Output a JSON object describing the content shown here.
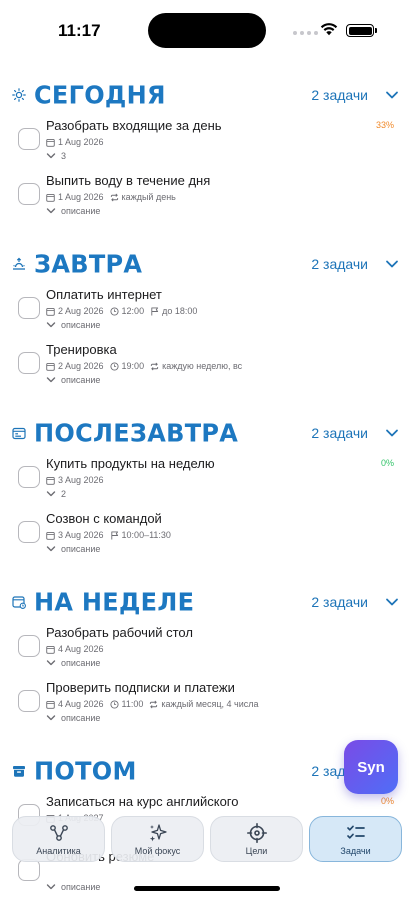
{
  "status_bar": {
    "time": "11:17"
  },
  "sections": [
    {
      "icon": "sun-icon",
      "title": "СЕГОДНЯ",
      "count": "2 задачи",
      "tasks": [
        {
          "title": "Разобрать входящие за день",
          "date": "1 Aug 2026",
          "time": "",
          "recurrence": "",
          "deadline": "",
          "sub": "3",
          "percent": "33%",
          "percent_color": "#f0892a"
        },
        {
          "title": "Выпить воду в течение дня",
          "date": "1 Aug 2026",
          "time": "",
          "recurrence": "каждый день",
          "deadline": "",
          "sub": "описание",
          "percent": "",
          "percent_color": ""
        }
      ]
    },
    {
      "icon": "sunrise-icon",
      "title": "ЗАВТРА",
      "count": "2 задачи",
      "tasks": [
        {
          "title": "Оплатить интернет",
          "date": "2 Aug 2026",
          "time": "12:00",
          "recurrence": "",
          "deadline": "до 18:00",
          "sub": "описание",
          "percent": "",
          "percent_color": ""
        },
        {
          "title": "Тренировка",
          "date": "2 Aug 2026",
          "time": "19:00",
          "recurrence": "каждую неделю, вс",
          "deadline": "",
          "sub": "описание",
          "percent": "",
          "percent_color": ""
        }
      ]
    },
    {
      "icon": "calendar-range-icon",
      "title": "ПОСЛЕЗАВТРА",
      "count": "2 задачи",
      "tasks": [
        {
          "title": "Купить продукты на неделю",
          "date": "3 Aug 2026",
          "time": "",
          "recurrence": "",
          "deadline": "",
          "sub": "2",
          "percent": "0%",
          "percent_color": "#34c46a"
        },
        {
          "title": "Созвон с командой",
          "date": "3 Aug 2026",
          "time": "",
          "recurrence": "",
          "deadline": "10:00–11:30",
          "sub": "описание",
          "percent": "",
          "percent_color": ""
        }
      ]
    },
    {
      "icon": "calendar-week-icon",
      "title": "НА НЕДЕЛЕ",
      "count": "2 задачи",
      "tasks": [
        {
          "title": "Разобрать рабочий стол",
          "date": "4 Aug 2026",
          "time": "",
          "recurrence": "",
          "deadline": "",
          "sub": "описание",
          "percent": "",
          "percent_color": ""
        },
        {
          "title": "Проверить подписки и платежи",
          "date": "4 Aug 2026",
          "time": "11:00",
          "recurrence": "каждый месяц, 4 числа",
          "deadline": "",
          "sub": "описание",
          "percent": "",
          "percent_color": ""
        }
      ]
    },
    {
      "icon": "archive-box-icon",
      "title": "ПОТОМ",
      "count": "2 задачи",
      "tasks": [
        {
          "title": "Записаться на курс английского",
          "date": "1 Aug 2027",
          "time": "",
          "recurrence": "",
          "deadline": "",
          "sub": "",
          "percent": "0%",
          "percent_color": "#f0892a"
        },
        {
          "title": "Обновить резюме",
          "date": "",
          "time": "",
          "recurrence": "",
          "deadline": "",
          "sub": "описание",
          "percent": "",
          "percent_color": ""
        }
      ]
    }
  ],
  "fab": {
    "label": "Syn"
  },
  "tab_bar": {
    "tabs": [
      {
        "label": "Аналитика",
        "icon": "analytics-graph-icon",
        "active": false
      },
      {
        "label": "Мой фокус",
        "icon": "sparkles-icon",
        "active": false
      },
      {
        "label": "Цели",
        "icon": "target-icon",
        "active": false
      },
      {
        "label": "Задачи",
        "icon": "checklist-icon",
        "active": true
      }
    ]
  },
  "colors": {
    "accent": "#1d78c1",
    "active_tab": "#d6e8f7",
    "fab_start": "#7a4be6",
    "fab_end": "#4f6ef7"
  }
}
